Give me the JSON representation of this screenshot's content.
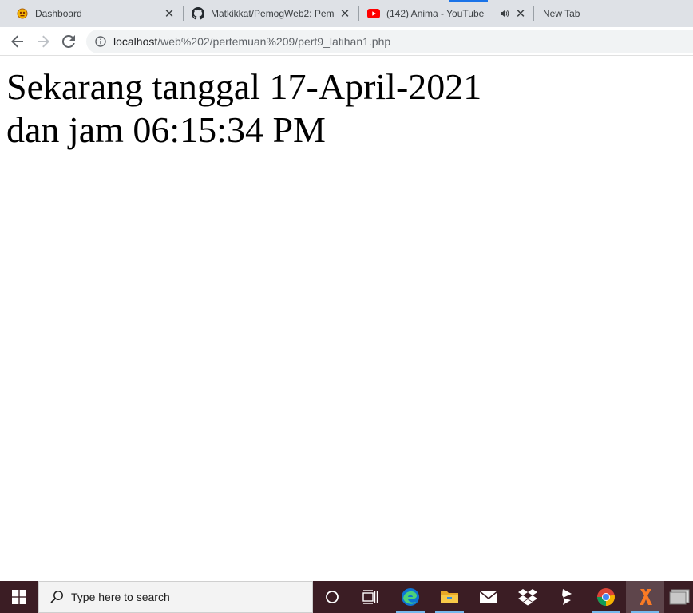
{
  "browser": {
    "tabs": [
      {
        "title": "Dashboard",
        "icon": "dashboard-favicon"
      },
      {
        "title": "Matkikkat/PemogWeb2: Pem",
        "icon": "github-icon"
      },
      {
        "title": "(142) Anima - YouTube",
        "icon": "youtube-icon",
        "audio": "speaker-icon"
      },
      {
        "title": "New Tab",
        "icon": "none"
      }
    ],
    "url_host": "localhost",
    "url_path": "/web%202/pertemuan%209/pert9_latihan1.php",
    "accent_color": "#1a73e8"
  },
  "page": {
    "line1": "Sekarang tanggal 17-April-2021",
    "line2": "dan jam 06:15:34 PM"
  },
  "taskbar": {
    "search_placeholder": "Type here to search",
    "background_color": "#3b1d24",
    "apps": [
      "cortana-icon",
      "task-view-icon",
      "edge-icon",
      "file-explorer-icon",
      "mail-icon",
      "dropbox-icon",
      "sublime-text-icon",
      "chrome-icon",
      "xampp-icon",
      "window-preview-icon"
    ]
  }
}
